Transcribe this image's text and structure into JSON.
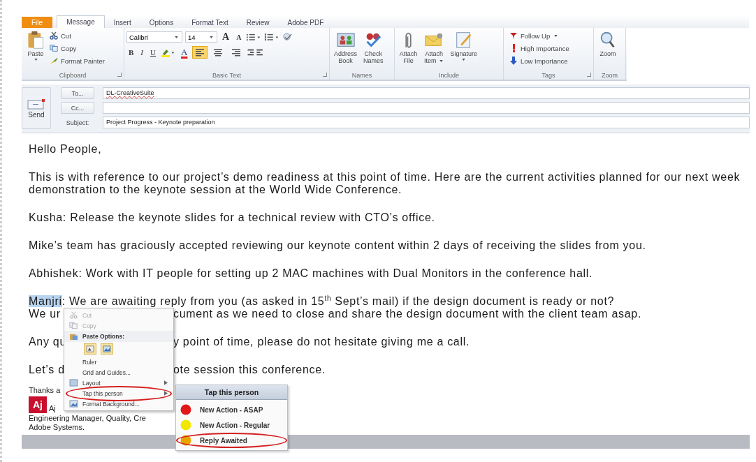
{
  "ribbon_tabs": [
    {
      "label": "File",
      "kind": "file",
      "selected": false
    },
    {
      "label": "Message",
      "kind": "tab",
      "selected": true
    },
    {
      "label": "Insert",
      "kind": "tab",
      "selected": false
    },
    {
      "label": "Options",
      "kind": "tab",
      "selected": false
    },
    {
      "label": "Format Text",
      "kind": "tab",
      "selected": false
    },
    {
      "label": "Review",
      "kind": "tab",
      "selected": false
    },
    {
      "label": "Adobe PDF",
      "kind": "tab",
      "selected": false
    }
  ],
  "clipboard": {
    "paste": "Paste",
    "items": [
      "Cut",
      "Copy",
      "Format Painter"
    ],
    "label": "Clipboard"
  },
  "basic_text": {
    "font": "Calibri",
    "size": "14",
    "grow": "A",
    "shrink": "A",
    "bold": "B",
    "italic": "I",
    "underline": "U",
    "font_color": "A",
    "align": [
      {
        "selected": true
      },
      {
        "selected": false
      },
      {
        "selected": false
      }
    ],
    "label": "Basic Text"
  },
  "names": {
    "buttons": [
      {
        "lines": [
          "Address",
          "Book"
        ]
      },
      {
        "lines": [
          "Check",
          "Names"
        ]
      }
    ],
    "label": "Names"
  },
  "include": {
    "buttons": [
      {
        "lines": [
          "Attach",
          "File"
        ],
        "dropdown": false
      },
      {
        "lines": [
          "Attach",
          "Item"
        ],
        "dropdown": true
      },
      {
        "lines": [
          "Signature"
        ],
        "dropdown": true
      }
    ],
    "label": "Include"
  },
  "tags": {
    "items": [
      {
        "label": "Follow Up",
        "dropdown": true
      },
      {
        "label": "High Importance",
        "dropdown": false
      },
      {
        "label": "Low Importance",
        "dropdown": false
      }
    ],
    "label": "Tags"
  },
  "zoom": {
    "button": "Zoom",
    "label": "Zoom"
  },
  "header": {
    "send": "Send",
    "to_button": "To...",
    "to_value": "DL-CreativeSuite",
    "cc_button": "Cc...",
    "subject_label": "Subject:",
    "subject_value": "Project Progress - Keynote preparation"
  },
  "paragraphs": [
    {
      "lines": [
        {
          "kind": "full",
          "text": "Hello People,"
        }
      ]
    },
    {
      "lines": [
        {
          "kind": "full",
          "text": "This is with reference to our project’s demo  readiness at this point of time. Here are the current activities planned for our next week"
        },
        {
          "kind": "full",
          "text": "demonstration to the keynote session at the World Wide Conference."
        }
      ]
    },
    {
      "lines": [
        {
          "kind": "full",
          "text": "Kusha: Release the keynote slides for a technical review with CTO’s office."
        }
      ]
    },
    {
      "lines": [
        {
          "kind": "full",
          "text": "Mike’s team has graciously accepted reviewing our keynote content within 2 days of receiving the slides from you."
        }
      ]
    },
    {
      "lines": [
        {
          "kind": "full",
          "text": "Abhishek: Work with IT people for setting up 2 MAC machines with Dual Monitors in the conference hall."
        }
      ]
    },
    {
      "lines": [
        {
          "kind": "highlight",
          "highlight": "Manjri",
          "text": ": We are awaiting reply from you (as asked in 15$^{th}$ Sept’s mail) if the design document is ready or not?"
        },
        {
          "kind": "split",
          "left": "We ur",
          "right": "cument as we need to close and share the design document with the client team asap."
        }
      ]
    },
    {
      "lines": [
        {
          "kind": "split",
          "left": "Any qu",
          "right": "y point of time, please do not hesitate giving me a call."
        }
      ]
    },
    {
      "lines": [
        {
          "kind": "split",
          "left": "Let’s d",
          "right": "ote session this conference."
        }
      ]
    }
  ],
  "signature": {
    "thanks": "Thanks a",
    "badge": "Aj",
    "name": "Aj",
    "title": "Engineering Manager, Quality, Cre",
    "company": "Adobe Systems."
  },
  "context_menu": {
    "items": [
      {
        "kind": "item",
        "label": "Cut",
        "disabled": true,
        "submenu": false,
        "circled": false
      },
      {
        "kind": "item",
        "label": "Copy",
        "disabled": true,
        "submenu": false,
        "circled": false
      },
      {
        "kind": "header",
        "label": "Paste Options:"
      },
      {
        "kind": "paste_buttons"
      },
      {
        "kind": "item",
        "label": "Ruler",
        "disabled": false,
        "submenu": false,
        "circled": false
      },
      {
        "kind": "item",
        "label": "Grid and Guides...",
        "disabled": false,
        "submenu": false,
        "circled": false
      },
      {
        "kind": "item",
        "label": "Layout",
        "disabled": false,
        "submenu": true,
        "circled": false
      },
      {
        "kind": "item",
        "label": "Tap this person",
        "disabled": false,
        "submenu": true,
        "circled": true
      },
      {
        "kind": "item",
        "label": "Format Background...",
        "disabled": false,
        "submenu": false,
        "circled": false
      }
    ]
  },
  "submenu": {
    "title": "Tap this person",
    "items": [
      {
        "label": "New Action - ASAP",
        "color": "#e01818",
        "circled": false
      },
      {
        "label": "New Action - Regular",
        "color": "#f0e800",
        "circled": false
      },
      {
        "label": "Reply Awaited",
        "color": "#e8a400",
        "circled": true
      }
    ]
  }
}
